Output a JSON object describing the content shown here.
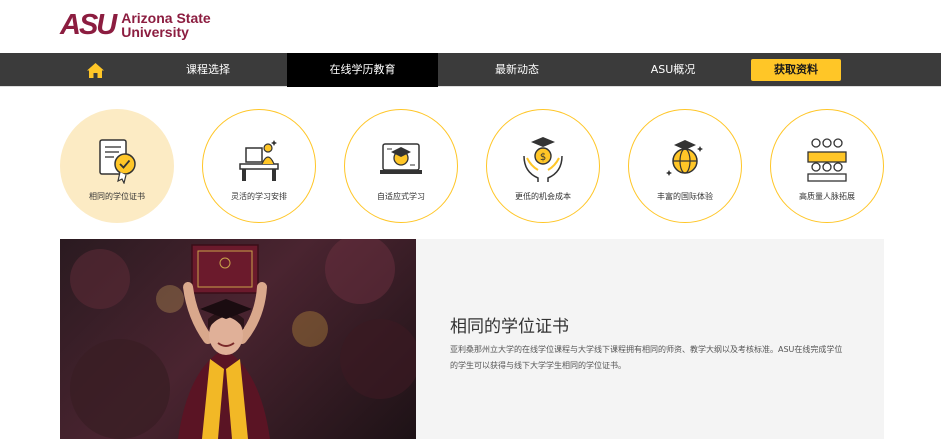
{
  "brand": {
    "mark": "ASU",
    "name_line1": "Arizona State",
    "name_line2": "University",
    "color_maroon": "#8c1d40",
    "color_gold": "#ffc627"
  },
  "nav": {
    "home_icon": "home-icon",
    "items": [
      {
        "label": "课程选择"
      },
      {
        "label": "在线学历教育"
      },
      {
        "label": "最新动态"
      },
      {
        "label": "ASU概况"
      }
    ],
    "cta_label": "获取资料"
  },
  "features": [
    {
      "label": "相同的学位证书",
      "icon": "certificate-icon"
    },
    {
      "label": "灵活的学习安排",
      "icon": "study-desk-icon"
    },
    {
      "label": "自适应式学习",
      "icon": "online-learning-icon"
    },
    {
      "label": "更低的机会成本",
      "icon": "hands-money-icon"
    },
    {
      "label": "丰富的国际体验",
      "icon": "globe-graduation-icon"
    },
    {
      "label": "高质量人脉拓展",
      "icon": "network-people-icon"
    }
  ],
  "content": {
    "title": "相同的学位证书",
    "description": "亚利桑那州立大学的在线学位课程与大学线下课程拥有相同的师资、教学大纲以及考核标准。ASU在线完成学位的学生可以获得与线下大学学生相同的学位证书。"
  }
}
